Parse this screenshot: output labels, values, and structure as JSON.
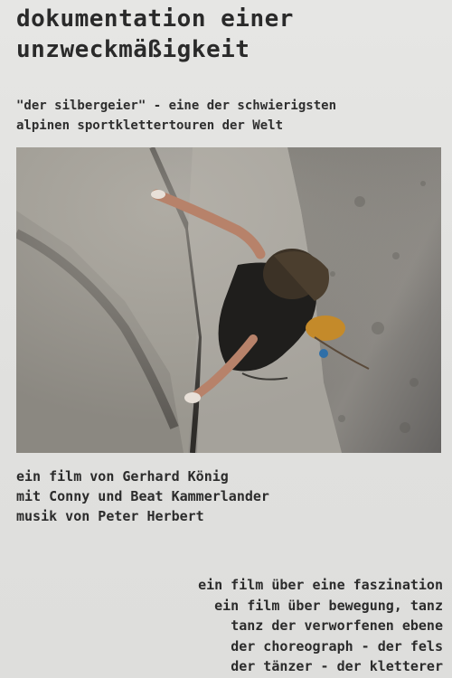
{
  "title": {
    "line1": "dokumentation einer",
    "line2": "unzweckmäßigkeit"
  },
  "subtitle": {
    "line1": "\"der silbergeier\" - eine der schwierigsten",
    "line2": "alpinen sportklettertouren der Welt"
  },
  "credits": {
    "director": "ein film von Gerhard König",
    "cast": "mit Conny und Beat Kammerlander",
    "music": "musik von Peter Herbert"
  },
  "tagline": [
    "ein film über eine faszination",
    "ein film über bewegung, tanz",
    "tanz der verworfenen ebene",
    "der choreograph - der fels",
    "der tänzer - der kletterer"
  ]
}
